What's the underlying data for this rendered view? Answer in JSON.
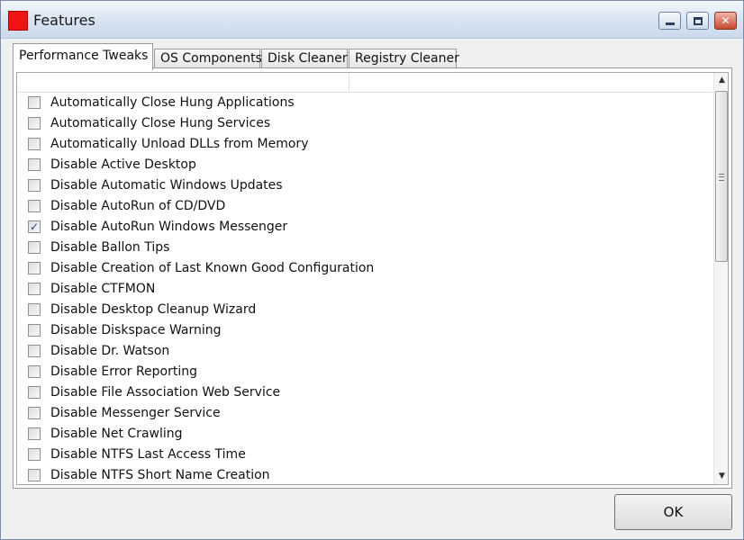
{
  "window": {
    "title": "Features",
    "accent_color": "#f01414"
  },
  "tabs": [
    {
      "label": "Performance Tweaks",
      "active": true
    },
    {
      "label": "OS Components",
      "active": false
    },
    {
      "label": "Disk Cleaner",
      "active": false
    },
    {
      "label": "Registry Cleaner",
      "active": false
    }
  ],
  "features": [
    {
      "label": "Automatically Close Hung Applications",
      "checked": false
    },
    {
      "label": "Automatically Close Hung Services",
      "checked": false
    },
    {
      "label": "Automatically Unload DLLs from Memory",
      "checked": false
    },
    {
      "label": "Disable Active Desktop",
      "checked": false
    },
    {
      "label": "Disable Automatic Windows Updates",
      "checked": false
    },
    {
      "label": "Disable AutoRun of CD/DVD",
      "checked": false
    },
    {
      "label": "Disable AutoRun Windows Messenger",
      "checked": true
    },
    {
      "label": "Disable Ballon Tips",
      "checked": false
    },
    {
      "label": "Disable Creation of Last Known Good Configuration",
      "checked": false
    },
    {
      "label": "Disable CTFMON",
      "checked": false
    },
    {
      "label": "Disable Desktop Cleanup Wizard",
      "checked": false
    },
    {
      "label": "Disable Diskspace Warning",
      "checked": false
    },
    {
      "label": "Disable Dr. Watson",
      "checked": false
    },
    {
      "label": "Disable Error Reporting",
      "checked": false
    },
    {
      "label": "Disable File Association Web Service",
      "checked": false
    },
    {
      "label": "Disable Messenger Service",
      "checked": false
    },
    {
      "label": "Disable Net Crawling",
      "checked": false
    },
    {
      "label": "Disable NTFS Last Access Time",
      "checked": false
    },
    {
      "label": "Disable NTFS Short Name Creation",
      "checked": false
    }
  ],
  "buttons": {
    "ok_label": "OK"
  },
  "icons": {
    "app": "app-icon",
    "minimize": "minimize-icon",
    "maximize": "maximize-icon",
    "close": "close-icon",
    "scroll_up": "scroll-up-icon",
    "scroll_down": "scroll-down-icon",
    "checkmark": "checkmark-icon"
  }
}
